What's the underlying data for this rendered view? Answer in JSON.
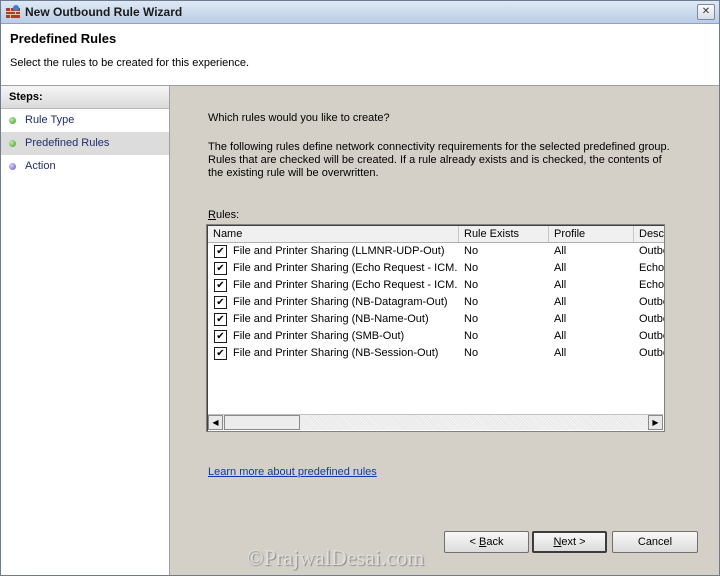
{
  "window": {
    "title": "New Outbound Rule Wizard",
    "close_glyph": "✕"
  },
  "header": {
    "title": "Predefined Rules",
    "subtitle": "Select the rules to be created for this experience."
  },
  "steps": {
    "label": "Steps:",
    "items": [
      {
        "label": "Rule Type",
        "status": "done"
      },
      {
        "label": "Predefined Rules",
        "status": "current"
      },
      {
        "label": "Action",
        "status": "pending"
      }
    ]
  },
  "main": {
    "question": "Which rules would you like to create?",
    "description": "The following rules define network connectivity requirements for the selected predefined group. Rules that are checked will be created. If a rule already exists and is checked, the contents of the existing rule will be overwritten.",
    "rules_label_accesskey": "R",
    "rules_label_rest": "ules:",
    "columns": [
      "Name",
      "Rule Exists",
      "Profile",
      "Desc"
    ],
    "rows": [
      {
        "checked": true,
        "name": "File and Printer Sharing (LLMNR-UDP-Out)",
        "exists": "No",
        "profile": "All",
        "desc": "Outbo"
      },
      {
        "checked": true,
        "name": "File and Printer Sharing (Echo Request - ICM...",
        "exists": "No",
        "profile": "All",
        "desc": "Echo"
      },
      {
        "checked": true,
        "name": "File and Printer Sharing (Echo Request - ICM...",
        "exists": "No",
        "profile": "All",
        "desc": "Echo"
      },
      {
        "checked": true,
        "name": "File and Printer Sharing (NB-Datagram-Out)",
        "exists": "No",
        "profile": "All",
        "desc": "Outbo"
      },
      {
        "checked": true,
        "name": "File and Printer Sharing (NB-Name-Out)",
        "exists": "No",
        "profile": "All",
        "desc": "Outbo"
      },
      {
        "checked": true,
        "name": "File and Printer Sharing (SMB-Out)",
        "exists": "No",
        "profile": "All",
        "desc": "Outbo"
      },
      {
        "checked": true,
        "name": "File and Printer Sharing (NB-Session-Out)",
        "exists": "No",
        "profile": "All",
        "desc": "Outbo"
      }
    ],
    "learn_more_link": "Learn more about predefined rules"
  },
  "buttons": {
    "back_prefix": "< ",
    "back_key": "B",
    "back_rest": "ack",
    "next_key": "N",
    "next_rest": "ext >",
    "cancel": "Cancel"
  },
  "watermark": "©PrajwalDesai.com",
  "colors": {
    "link": "#0b3aa8",
    "step_done": "#3e9b2a",
    "step_pending": "#5c55c4",
    "content_bg": "#d4d0c8"
  }
}
